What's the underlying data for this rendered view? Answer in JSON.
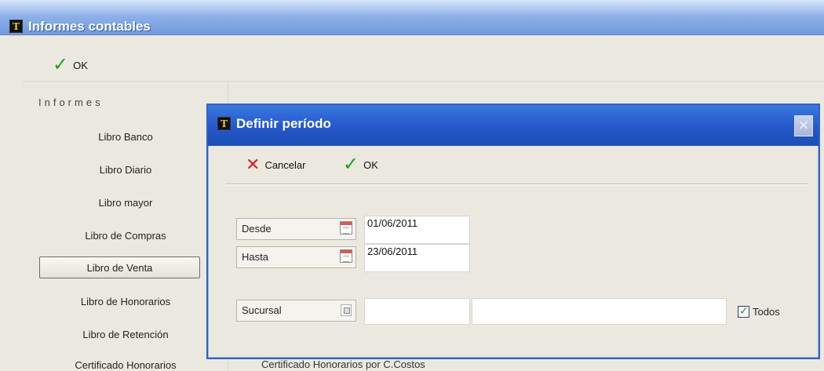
{
  "main_window": {
    "title": "Informes contables",
    "logo_text": "T",
    "toolbar": {
      "ok_label": "OK"
    },
    "sidebar": {
      "section_title": "Informes",
      "items": [
        "Libro Banco",
        "Libro Diario",
        "Libro mayor",
        "Libro de Compras",
        "Libro de Venta",
        "Libro de Honorarios",
        "Libro de Retención",
        "Certificado Honorarios"
      ],
      "selected": "Libro de Venta"
    },
    "partial_item": "Certificado Honorarios por C.Costos"
  },
  "dialog": {
    "title": "Definir período",
    "logo_text": "T",
    "toolbar": {
      "cancel_label": "Cancelar",
      "ok_label": "OK"
    },
    "fields": {
      "desde_label": "Desde",
      "desde_value": "01/06/2011",
      "hasta_label": "Hasta",
      "hasta_value": "23/06/2011",
      "sucursal_label": "Sucursal",
      "sucursal_code": "",
      "sucursal_name": "",
      "todos_label": "Todos",
      "todos_checked": true
    }
  }
}
